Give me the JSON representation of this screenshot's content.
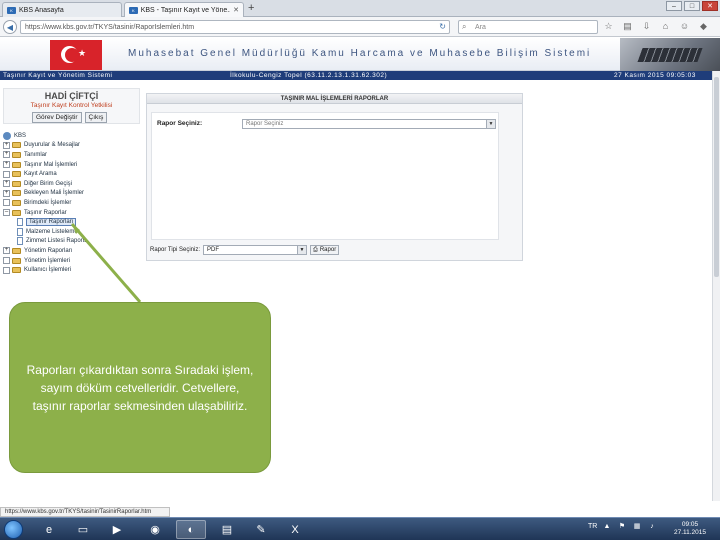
{
  "browser": {
    "tabs": [
      {
        "label": "KBS Anasayfa",
        "active": false
      },
      {
        "label": "KBS - Taşınır Kayıt ve Yöne...",
        "active": true
      }
    ],
    "new_tab": "+",
    "window_buttons": [
      "–",
      "□",
      "✕"
    ],
    "url": "https://www.kbs.gov.tr/TKYS/tasinir/RaporIslemleri.htm",
    "search_placeholder": "Ara"
  },
  "header": {
    "title": "Muhasebat Genel Müdürlüğü Kamu Harcama ve Muhasebe Bilişim Sistemi"
  },
  "infobar": {
    "left": "Taşınır Kayıt ve Yönetim Sistemi",
    "middle": "İlkokulu-Cengiz Topel (63.11.2.13.1.31.62.302)",
    "right": "27 Kasım 2015 09:05:03"
  },
  "user": {
    "name": "HADİ ÇİFTÇİ",
    "unit": "Taşınır Kayıt Kontrol Yetkilisi",
    "change_role": "Görev Değiştir",
    "logout": "Çıkış"
  },
  "tree": {
    "root": "KBS",
    "items": [
      {
        "label": "Duyurular & Mesajlar",
        "expander": "+"
      },
      {
        "label": "Tanımlar",
        "expander": "+"
      },
      {
        "label": "Taşınır Mal İşlemleri",
        "expander": "+"
      },
      {
        "label": "Kayıt Arama",
        "expander": " "
      },
      {
        "label": "Diğer Birim Geçişi",
        "expander": "+"
      },
      {
        "label": "Bekleyen Mali İşlemler",
        "expander": "+"
      },
      {
        "label": "Birimdeki İşlemler",
        "expander": " "
      },
      {
        "label": "Taşınır Raporlar",
        "expander": "–"
      }
    ],
    "subitems": [
      {
        "label": "Taşınır Raporları",
        "selected": true
      },
      {
        "label": "Malzeme Listeleme",
        "selected": false
      },
      {
        "label": "Zimmet Listesi Raporu",
        "selected": false
      }
    ],
    "items_after": [
      {
        "label": "Yönetim Raporları",
        "expander": "+"
      },
      {
        "label": "Yönetim İşlemleri",
        "expander": " "
      },
      {
        "label": "Kullanıcı İşlemleri",
        "expander": " "
      }
    ]
  },
  "panel": {
    "title": "TAŞINIR MAL İŞLEMLERİ RAPORLAR",
    "rapor_label": "Rapor Seçiniz:",
    "rapor_value": "Rapor Seçiniz",
    "format_label": "Rapor Tipi Seçiniz:",
    "format_value": "PDF",
    "rapor_button": "Rapor"
  },
  "callout": {
    "text": "Raporları çıkardıktan sonra Sıradaki işlem, sayım döküm cetvelleridir. Cetvellere, taşınır raporlar sekmesinden  ulaşabiliriz."
  },
  "status_text": "https://www.kbs.gov.tr/TKYS/tasinir/TasinirRaporlar.htm",
  "taskbar": {
    "apps": [
      "ie-icon",
      "explorer-icon",
      "media-icon",
      "chrome-icon",
      "firefox-icon",
      "folder-icon",
      "paint-icon",
      "excel-icon"
    ],
    "tray_lang": "TR",
    "time": "09:05",
    "date": "27.11.2015"
  }
}
